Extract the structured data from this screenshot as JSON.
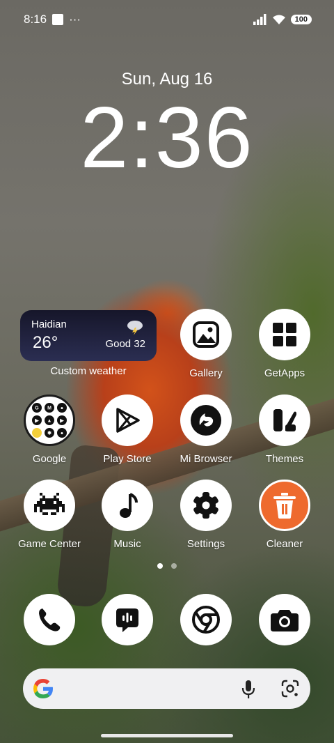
{
  "status_bar": {
    "time": "8:16",
    "more": "···",
    "battery": "100"
  },
  "lock": {
    "date": "Sun, Aug 16",
    "time": "2:36"
  },
  "weather_widget": {
    "city": "Haidian",
    "temperature": "26°",
    "air_quality": "Good 32",
    "label": "Custom weather"
  },
  "apps": {
    "gallery": "Gallery",
    "getapps": "GetApps",
    "google": "Google",
    "play_store": "Play Store",
    "mi_browser": "Mi Browser",
    "themes": "Themes",
    "game_center": "Game Center",
    "music": "Music",
    "settings": "Settings",
    "cleaner": "Cleaner"
  },
  "dock": [
    "phone-icon",
    "messages-icon",
    "chrome-icon",
    "camera-icon"
  ],
  "page_indicator": {
    "pages": 2,
    "current": 1
  },
  "colors": {
    "cleaner_accent": "#ee6a2e",
    "weather_bg": "#1d1e3a"
  }
}
